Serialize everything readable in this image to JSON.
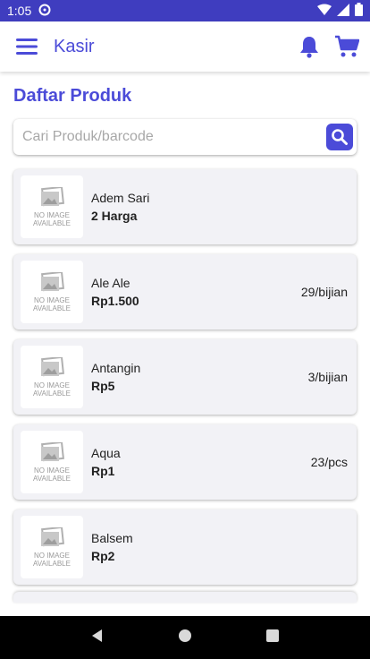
{
  "colors": {
    "accent": "#4b4bd8",
    "accent_dark": "#3f3dbf",
    "card_bg": "#f2f2f6"
  },
  "status_bar": {
    "time": "1:05"
  },
  "appbar": {
    "title": "Kasir",
    "menu_icon": "hamburger-menu-icon",
    "bell_icon": "bell-icon",
    "cart_icon": "cart-icon"
  },
  "page": {
    "title": "Daftar Produk"
  },
  "search": {
    "placeholder": "Cari Produk/barcode",
    "icon": "search-icon"
  },
  "thumb": {
    "text": "NO IMAGE AVAILABLE"
  },
  "products": [
    {
      "name": "Adem Sari",
      "price": "2 Harga",
      "stock": ""
    },
    {
      "name": "Ale Ale",
      "price": "Rp1.500",
      "stock": "29/bijian"
    },
    {
      "name": "Antangin",
      "price": "Rp5",
      "stock": "3/bijian"
    },
    {
      "name": "Aqua",
      "price": "Rp1",
      "stock": "23/pcs"
    },
    {
      "name": "Balsem",
      "price": "Rp2",
      "stock": ""
    }
  ]
}
